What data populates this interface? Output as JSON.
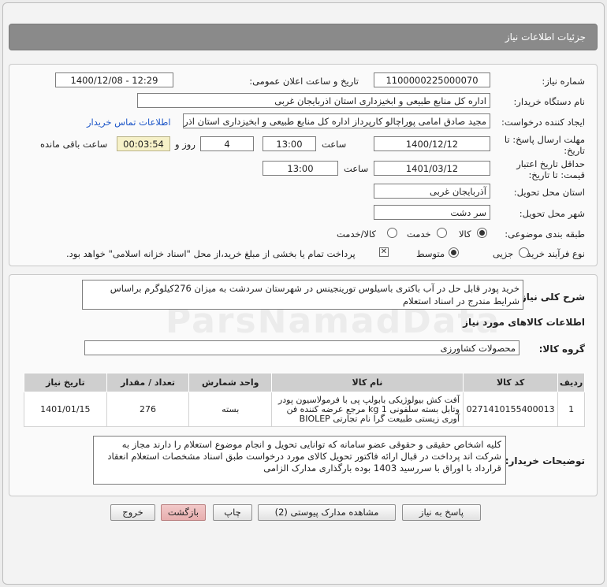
{
  "header": {
    "title": "جزئیات اطلاعات نیاز"
  },
  "form": {
    "need_number_label": "شماره نیاز:",
    "need_number": "1100000225000070",
    "announce_label": "تاریخ و ساعت اعلان عمومی:",
    "announce_value": "1400/12/08 - 12:29",
    "buyer_org_label": "نام دستگاه خریدار:",
    "buyer_org": "اداره کل منابع طبیعی و ابخیزداری استان اذربایجان غربی",
    "creator_label": "ایجاد کننده درخواست:",
    "creator": "مجید صادق امامی پوراچالو کارپرداز اداره کل منابع طبیعی و ابخیزداری استان اذربا",
    "contact_link": "اطلاعات تماس خریدار",
    "reply_deadline_label": "مهلت ارسال پاسخ: تا",
    "reply_deadline_label2": "تاریخ:",
    "reply_date": "1400/12/12",
    "time_label": "ساعت",
    "reply_time": "13:00",
    "days_value": "4",
    "days_label": "روز و",
    "remaining_time": "00:03:54",
    "remaining_label": "ساعت باقی مانده",
    "validity_label": "حداقل تاریخ اعتبار",
    "validity_label2": "قیمت: تا تاریخ:",
    "validity_date": "1401/03/12",
    "validity_time": "13:00",
    "delivery_province_label": "استان محل تحویل:",
    "delivery_province": "آذربایجان غربی",
    "delivery_city_label": "شهر محل تحویل:",
    "delivery_city": "سر دشت",
    "category_label": "طبقه بندی موضوعی:",
    "category_options": [
      "کالا",
      "خدمت",
      "کالا/خدمت"
    ],
    "category_selected": "کالا",
    "process_label": "نوع فرآیند خرید :",
    "process_options": [
      "جزیی",
      "متوسط"
    ],
    "process_selected": "متوسط",
    "payment_note": "پرداخت تمام یا بخشی از مبلغ خرید،از محل \"اسناد خزانه اسلامی\" خواهد بود."
  },
  "summary": {
    "label": "شرح کلی نیاز:",
    "text": "خرید پودر قابل حل در آب باکتری باسیلوس تورینجینس در شهرستان سردشت به میزان 276کیلوگرم براساس شرایط مندرج در اسناد استعلام"
  },
  "goods": {
    "section_title": "اطلاعات کالاهای مورد نیاز",
    "group_label": "گروه کالا:",
    "group_value": "محصولات کشاورزی",
    "columns": [
      "ردیف",
      "کد کالا",
      "نام کالا",
      "واحد شمارش",
      "تعداد / مقدار",
      "تاریخ نیاز"
    ],
    "rows": [
      {
        "index": "1",
        "code": "0271410155400013",
        "name": "آفت کش بیولوژیکی بابولپ پی با فرمولاسیون پودر وتابل بسته سلفونی 1 kg مرجع عرضه کننده فن آوری زیستی طبیعت گرا نام تجارتی BIOLEP",
        "unit": "بسته",
        "qty": "276",
        "date": "1401/01/15"
      }
    ]
  },
  "buyer_notes": {
    "label": "توضیحات خریدار:",
    "text": "کلیه اشخاص حقیقی و حقوقی عضو سامانه که توانایی تحویل و انجام موضوع استعلام را دارند مجاز به شرکت اند پرداخت در قبال ارائه فاکتور تحویل کالای مورد درخواست طبق اسناد مشخصات استعلام انعقاد قرارداد با اوراق با سررسید 1403 بوده بارگذاری مدارک الزامی"
  },
  "buttons": {
    "reply": "پاسخ به نیاز",
    "view_docs": "مشاهده مدارک پیوستی (2)",
    "print": "چاپ",
    "back": "بازگشت",
    "exit": "خروج"
  }
}
